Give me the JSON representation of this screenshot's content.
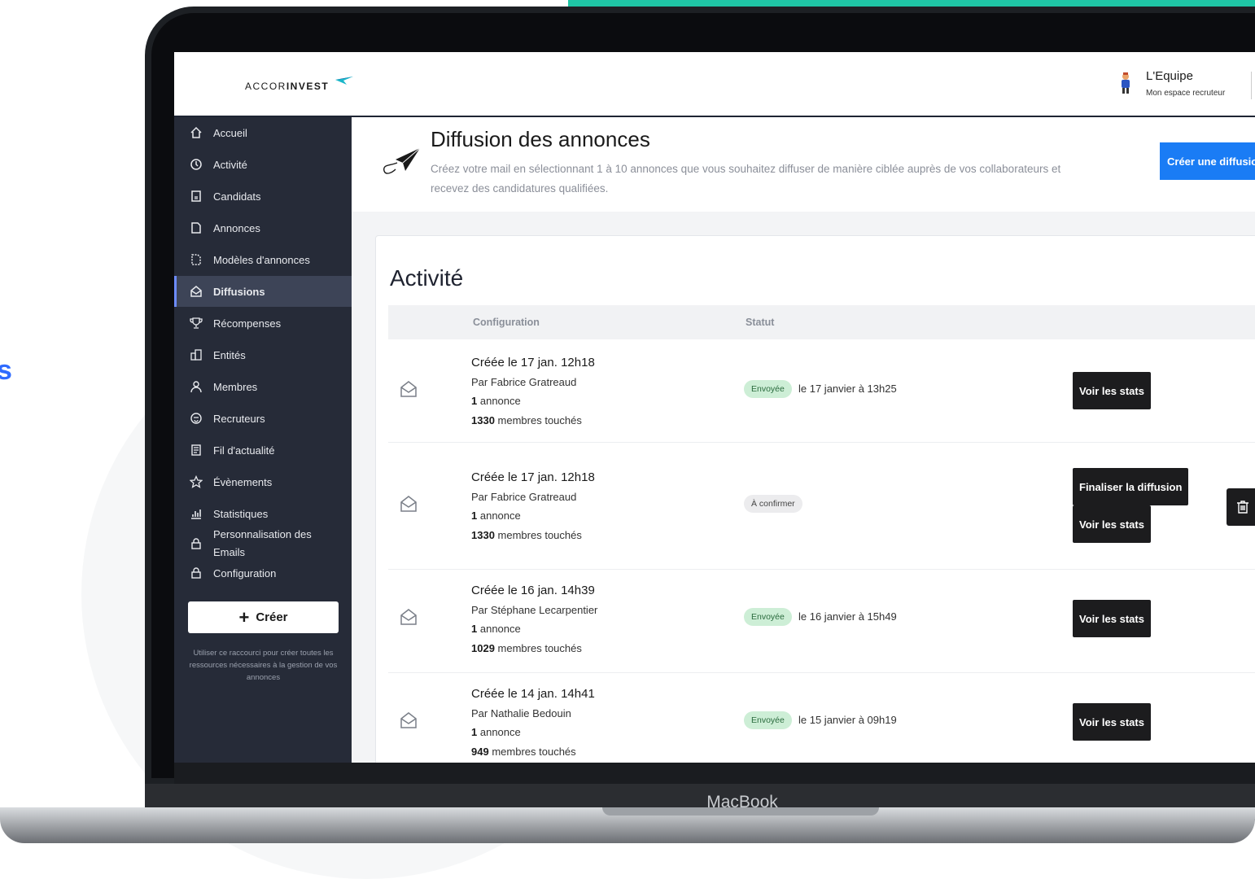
{
  "side_fragment": "s",
  "device_label": "MacBook",
  "app": {
    "logo_prefix": "ACCOR",
    "logo_bold": "INVEST",
    "user_name": "L'Equipe",
    "user_subtitle": "Mon espace recruteur"
  },
  "sidebar": {
    "items": [
      {
        "label": "Accueil",
        "icon": "home-icon"
      },
      {
        "label": "Activité",
        "icon": "activity-icon"
      },
      {
        "label": "Candidats",
        "icon": "candidates-icon"
      },
      {
        "label": "Annonces",
        "icon": "document-icon"
      },
      {
        "label": "Modèles d'annonces",
        "icon": "template-icon"
      },
      {
        "label": "Diffusions",
        "icon": "diffusion-icon",
        "active": true
      },
      {
        "label": "Récompenses",
        "icon": "trophy-icon"
      },
      {
        "label": "Entités",
        "icon": "building-icon"
      },
      {
        "label": "Membres",
        "icon": "user-icon"
      },
      {
        "label": "Recruteurs",
        "icon": "recruiter-icon"
      },
      {
        "label": "Fil d'actualité",
        "icon": "news-icon"
      },
      {
        "label": "Évènements",
        "icon": "star-icon"
      },
      {
        "label": "Statistiques",
        "icon": "stats-icon"
      },
      {
        "label": "Personnalisation des Emails",
        "icon": "lock-icon"
      },
      {
        "label": "Configuration",
        "icon": "lock-icon"
      }
    ],
    "create_button": "Créer",
    "create_help": "Utiliser ce raccourci pour créer toutes les ressources nécessaires à la gestion de vos annonces"
  },
  "header": {
    "title": "Diffusion des annonces",
    "description": "Créez votre mail en sélectionnant 1 à 10 annonces que vous souhaitez diffuser de manière ciblée auprès de vos collaborateurs et recevez des candidatures qualifiées.",
    "primary_button": "Créer une diffusion"
  },
  "activity": {
    "title": "Activité",
    "columns": [
      "Configuration",
      "Statut"
    ],
    "rows": [
      {
        "created": "Créée le 17 jan. 12h18",
        "author": "Par Fabrice Gratreaud",
        "count": "1",
        "count_label": "annonce",
        "members": "1330",
        "members_label": "membres touchés",
        "status": "Envoyée",
        "status_detail": "le 17 janvier à 13h25",
        "actions": [
          "Voir les stats"
        ]
      },
      {
        "created": "Créée le 17 jan. 12h18",
        "author": "Par Fabrice Gratreaud",
        "count": "1",
        "count_label": "annonce",
        "members": "1330",
        "members_label": "membres touchés",
        "status": "À confirmer",
        "status_detail": "",
        "actions": [
          "Finaliser la diffusion",
          "Voir les stats"
        ]
      },
      {
        "created": "Créée le 16 jan. 14h39",
        "author": "Par Stéphane Lecarpentier",
        "count": "1",
        "count_label": "annonce",
        "members": "1029",
        "members_label": "membres touchés",
        "status": "Envoyée",
        "status_detail": "le 16 janvier à 15h49",
        "actions": [
          "Voir les stats"
        ]
      },
      {
        "created": "Créée le 14 jan. 14h41",
        "author": "Par Nathalie Bedouin",
        "count": "1",
        "count_label": "annonce",
        "members": "949",
        "members_label": "membres touchés",
        "status": "Envoyée",
        "status_detail": "le 15 janvier à 09h19",
        "actions": [
          "Voir les stats"
        ]
      }
    ]
  },
  "colors": {
    "sidebar_bg": "#262b38",
    "accent_blue": "#1a7cf5",
    "teal": "#1fc6a6",
    "badge_green": "#cdeed6"
  }
}
